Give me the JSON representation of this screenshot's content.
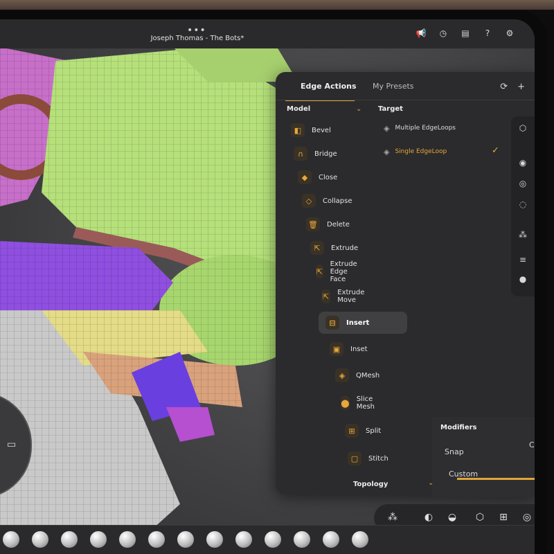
{
  "app": {
    "document_title": "Joseph Thomas - The Bots*",
    "menu_dots": "•••"
  },
  "top_icons": [
    "megaphone-icon",
    "history-icon",
    "layout-icon",
    "help-icon",
    "settings-icon"
  ],
  "panel": {
    "tabs": [
      {
        "label": "Edge Actions",
        "active": true
      },
      {
        "label": "My Presets",
        "active": false
      }
    ],
    "model_section": {
      "title": "Model",
      "tools": [
        {
          "label": "Bevel",
          "icon": "bevel-icon"
        },
        {
          "label": "Bridge",
          "icon": "bridge-icon"
        },
        {
          "label": "Close",
          "icon": "close-icon"
        },
        {
          "label": "Collapse",
          "icon": "collapse-icon"
        },
        {
          "label": "Delete",
          "icon": "delete-icon"
        },
        {
          "label": "Extrude",
          "icon": "extrude-icon"
        },
        {
          "label": "Extrude Edge Face",
          "icon": "extrude-edge-face-icon"
        },
        {
          "label": "Extrude Move",
          "icon": "extrude-move-icon"
        },
        {
          "label": "Insert",
          "icon": "insert-icon",
          "active": true
        },
        {
          "label": "Inset",
          "icon": "inset-icon"
        },
        {
          "label": "QMesh",
          "icon": "qmesh-icon"
        },
        {
          "label": "Slice Mesh",
          "icon": "slice-mesh-icon"
        },
        {
          "label": "Split",
          "icon": "split-icon"
        },
        {
          "label": "Stitch",
          "icon": "stitch-icon"
        }
      ]
    },
    "topology_section": {
      "title": "Topology"
    },
    "target_section": {
      "title": "Target",
      "items": [
        {
          "label": "Multiple EdgeLoops",
          "selected": false
        },
        {
          "label": "Single EdgeLoop",
          "selected": true
        }
      ]
    }
  },
  "modifiers": {
    "title": "Modifiers",
    "snap_label": "Snap",
    "snap_value": "Custom",
    "custom_label": "Custom"
  },
  "colors": {
    "accent": "#e0a53a",
    "panel_bg": "#2b2b2d",
    "mesh_green": "#b5e07a",
    "mesh_magenta": "#c76fc9",
    "mesh_purple": "#8f4fe0",
    "mesh_tan": "#d9a27c"
  }
}
